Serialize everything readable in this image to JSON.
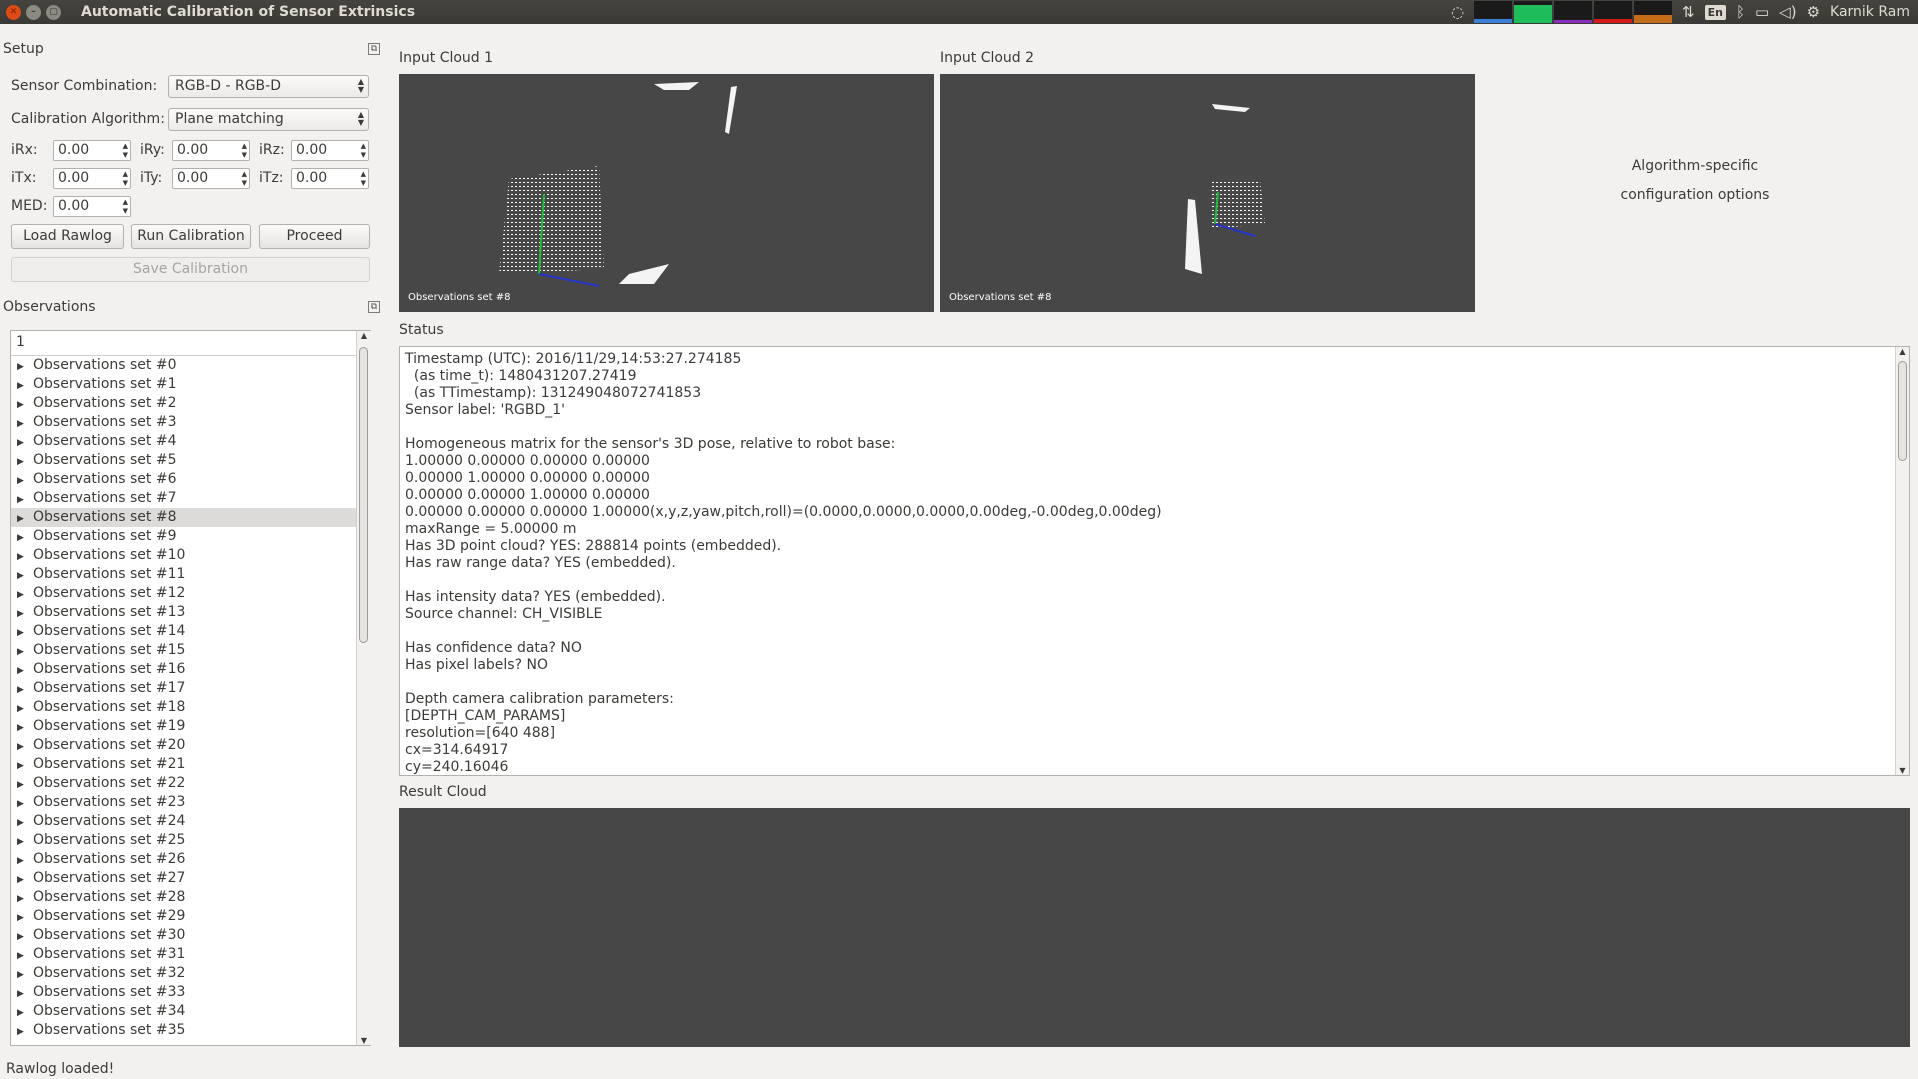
{
  "window": {
    "title": "Automatic Calibration of Sensor Extrinsics",
    "user": "Karnik Ram",
    "keyboard": "En"
  },
  "setup": {
    "title": "Setup",
    "sensor_combination_label": "Sensor Combination:",
    "sensor_combination_value": "RGB-D - RGB-D",
    "algorithm_label": "Calibration Algorithm:",
    "algorithm_value": "Plane matching",
    "irx_label": "iRx:",
    "irx_value": "0.00",
    "iry_label": "iRy:",
    "iry_value": "0.00",
    "irz_label": "iRz:",
    "irz_value": "0.00",
    "itx_label": "iTx:",
    "itx_value": "0.00",
    "ity_label": "iTy:",
    "ity_value": "0.00",
    "itz_label": "iTz:",
    "itz_value": "0.00",
    "med_label": "MED:",
    "med_value": "0.00",
    "load_rawlog": "Load Rawlog",
    "run_calibration": "Run Calibration",
    "proceed": "Proceed",
    "save_calibration": "Save Calibration"
  },
  "observations": {
    "title": "Observations",
    "header": "1",
    "selected_index": 8,
    "items": [
      "Observations set #0",
      "Observations set #1",
      "Observations set #2",
      "Observations set #3",
      "Observations set #4",
      "Observations set #5",
      "Observations set #6",
      "Observations set #7",
      "Observations set #8",
      "Observations set #9",
      "Observations set #10",
      "Observations set #11",
      "Observations set #12",
      "Observations set #13",
      "Observations set #14",
      "Observations set #15",
      "Observations set #16",
      "Observations set #17",
      "Observations set #18",
      "Observations set #19",
      "Observations set #20",
      "Observations set #21",
      "Observations set #22",
      "Observations set #23",
      "Observations set #24",
      "Observations set #25",
      "Observations set #26",
      "Observations set #27",
      "Observations set #28",
      "Observations set #29",
      "Observations set #30",
      "Observations set #31",
      "Observations set #32",
      "Observations set #33",
      "Observations set #34",
      "Observations set #35"
    ]
  },
  "views": {
    "input_cloud_1_title": "Input Cloud 1",
    "input_cloud_1_caption": "Observations set #8",
    "input_cloud_2_title": "Input Cloud 2",
    "input_cloud_2_caption": "Observations set #8",
    "algo_options_line1": "Algorithm-specific",
    "algo_options_line2": "configuration options",
    "result_cloud_title": "Result Cloud"
  },
  "status": {
    "title": "Status",
    "lines": [
      "Timestamp (UTC): 2016/11/29,14:53:27.274185",
      "  (as time_t): 1480431207.27419",
      "  (as TTimestamp): 131249048072741853",
      "Sensor label: 'RGBD_1'",
      "",
      "Homogeneous matrix for the sensor's 3D pose, relative to robot base:",
      "1.00000 0.00000 0.00000 0.00000",
      "0.00000 1.00000 0.00000 0.00000",
      "0.00000 0.00000 1.00000 0.00000",
      "0.00000 0.00000 0.00000 1.00000(x,y,z,yaw,pitch,roll)=(0.0000,0.0000,0.0000,0.00deg,-0.00deg,0.00deg)",
      "maxRange = 5.00000 m",
      "Has 3D point cloud? YES: 288814 points (embedded).",
      "Has raw range data? YES (embedded).",
      "",
      "Has intensity data? YES (embedded).",
      "Source channel: CH_VISIBLE",
      "",
      "Has confidence data? NO",
      "Has pixel labels? NO",
      "",
      "Depth camera calibration parameters:",
      "[DEPTH_CAM_PARAMS]",
      "resolution=[640 488]",
      "cx=314.64917",
      "cy=240.16046"
    ]
  },
  "statusbar": {
    "message": "Rawlog loaded!"
  },
  "colors": {
    "view_bg": "#474747",
    "titlebar": "#3a3935",
    "close_button": "#df4b16"
  }
}
